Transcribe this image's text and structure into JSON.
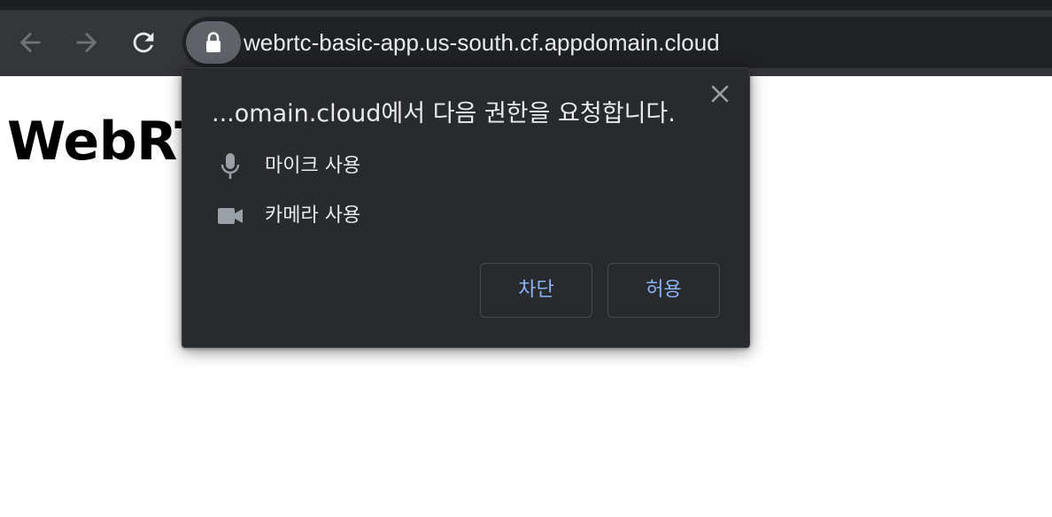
{
  "browser": {
    "url": "webrtc-basic-app.us-south.cf.appdomain.cloud",
    "icons": {
      "back": "arrow-left-icon",
      "forward": "arrow-right-icon",
      "reload": "reload-icon",
      "lock": "lock-icon"
    }
  },
  "page": {
    "heading": "WebRTC Tutorial - Plain"
  },
  "permission_popup": {
    "title": "...omain.cloud에서 다음 권한을 요청합니다.",
    "permissions": [
      {
        "icon": "microphone-icon",
        "label": "마이크 사용"
      },
      {
        "icon": "camera-icon",
        "label": "카메라 사용"
      }
    ],
    "block_label": "차단",
    "allow_label": "허용",
    "accent_color": "#8ab4f8"
  }
}
